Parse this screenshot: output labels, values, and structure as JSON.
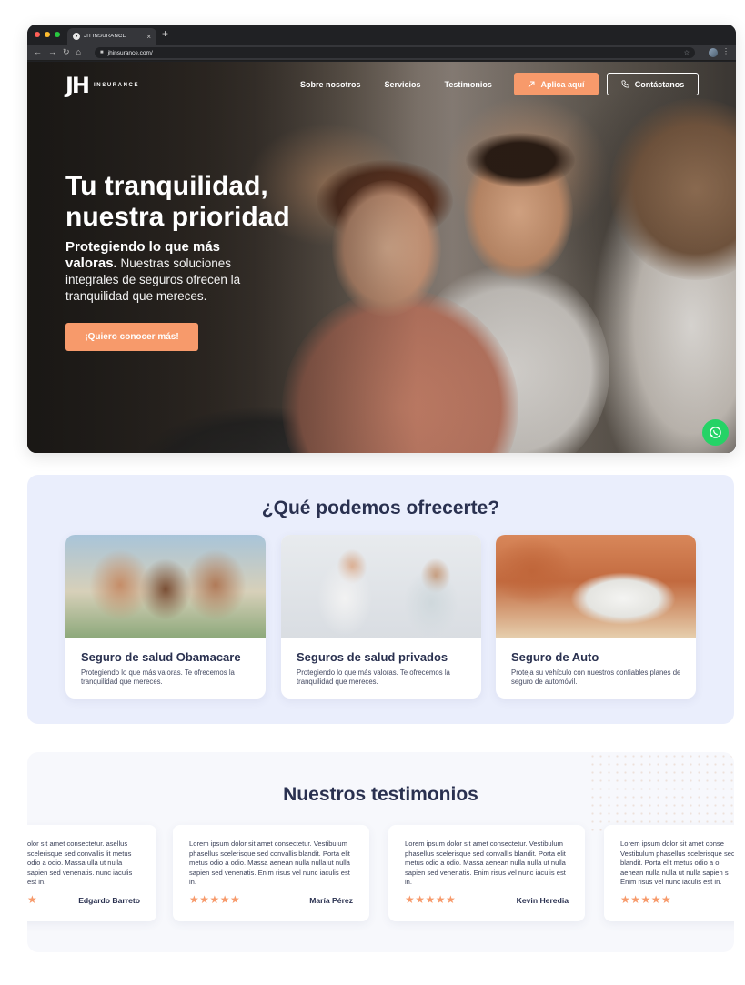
{
  "browser": {
    "tab_title": "JH INSURANCE",
    "url": "jhinsurance.com/",
    "dot_colors": [
      "#ff5f57",
      "#febc2e",
      "#28c840"
    ]
  },
  "header": {
    "logo_mark": "JH",
    "logo_word": "INSURANCE",
    "nav": [
      "Sobre nosotros",
      "Servicios",
      "Testimonios"
    ],
    "apply_label": "Aplica aquí",
    "contact_label": "Contáctanos"
  },
  "hero": {
    "title_line1": "Tu tranquilidad,",
    "title_line2": "nuestra prioridad",
    "subtitle_bold": "Protegiendo lo que más valoras.",
    "subtitle_rest": " Nuestras soluciones integrales de seguros ofrecen la tranquilidad que mereces.",
    "cta": "¡Quiero conocer más!"
  },
  "services": {
    "title": "¿Qué podemos ofrecerte?",
    "cards": [
      {
        "title": "Seguro de salud Obamacare",
        "desc": "Protegiendo lo que más valoras. Te ofrecemos la tranquilidad que mereces."
      },
      {
        "title": "Seguros de salud privados",
        "desc": "Protegiendo lo que más valoras. Te ofrecemos la tranquilidad que mereces."
      },
      {
        "title": "Seguro de Auto",
        "desc": "Proteja su vehículo con nuestros confiables planes de seguro de automóvil."
      }
    ]
  },
  "testimonials": {
    "title": "Nuestros testimonios",
    "items": [
      {
        "text": "olor sit amet consectetur. asellus scelerisque sed convallis lit metus odio a odio. Massa ulla ut nulla sapien sed venenatis. nunc iaculis est in.",
        "name": "Edgardo Barreto",
        "stars": "★"
      },
      {
        "text": "Lorem ipsum dolor sit amet consectetur. Vestibulum phasellus scelerisque sed convallis blandit. Porta elit metus odio a odio. Massa aenean nulla nulla ut nulla sapien sed venenatis. Enim risus vel nunc iaculis est in.",
        "name": "María Pérez",
        "stars": "★★★★★"
      },
      {
        "text": "Lorem ipsum dolor sit amet consectetur. Vestibulum phasellus scelerisque sed convallis blandit. Porta elit metus odio a odio. Massa aenean nulla nulla ut nulla sapien sed venenatis. Enim risus vel nunc iaculis est in.",
        "name": "Kevin Heredia",
        "stars": "★★★★★"
      },
      {
        "text": "Lorem ipsum dolor sit amet conse Vestibulum phasellus scelerisque sed blandit. Porta elit metus odio a o aenean nulla nulla ut nulla sapien s Enim risus vel nunc iaculis est in.",
        "name": "",
        "stars": "★★★★★"
      }
    ]
  },
  "colors": {
    "accent": "#f79a6b",
    "heading": "#2a3150",
    "services_bg": "#eaeefc",
    "whatsapp": "#25d366"
  },
  "icons": {
    "whatsapp": "whatsapp-icon",
    "phone": "phone-icon",
    "arrow": "arrow-up-right-icon"
  }
}
